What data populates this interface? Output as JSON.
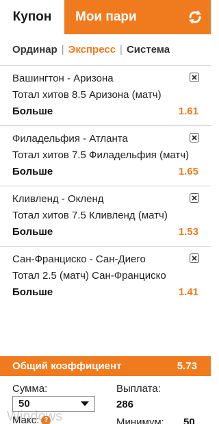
{
  "header": {
    "tab_coupon": "Купон",
    "tab_my_bets": "Мои пари",
    "refresh_icon": "refresh-icon"
  },
  "bet_types": {
    "ordinar": "Ординар",
    "express": "Экспресс",
    "system": "Система",
    "active": "express",
    "separator": "|"
  },
  "bets": [
    {
      "match": "Вашингтон - Аризона",
      "market": "Тотал хитов 8.5 Аризона (матч)",
      "outcome": "Больше",
      "odds": "1.61"
    },
    {
      "match": "Филадельфия - Атланта",
      "market": "Тотал хитов 7.5 Филадельфия (матч)",
      "outcome": "Больше",
      "odds": "1.65"
    },
    {
      "match": "Кливленд - Окленд",
      "market": "Тотал хитов 7.5 Кливленд (матч)",
      "outcome": "Больше",
      "odds": "1.53"
    },
    {
      "match": "Сан-Франциско - Сан-Диего",
      "market": "Тотал 2.5 (матч) Сан-Франциско",
      "outcome": "Больше",
      "odds": "1.41"
    }
  ],
  "total": {
    "label": "Общий коэффициент",
    "value": "5.73"
  },
  "stake": {
    "sum_label": "Сумма:",
    "sum_value": "50",
    "payout_label": "Выплата:",
    "payout_value": "286",
    "max_label": "Макс:",
    "help_glyph": "?",
    "min_label": "Минимум:",
    "min_value": "50"
  },
  "watermark": "Windows",
  "colors": {
    "accent": "#f07b1e",
    "text": "#222222"
  }
}
